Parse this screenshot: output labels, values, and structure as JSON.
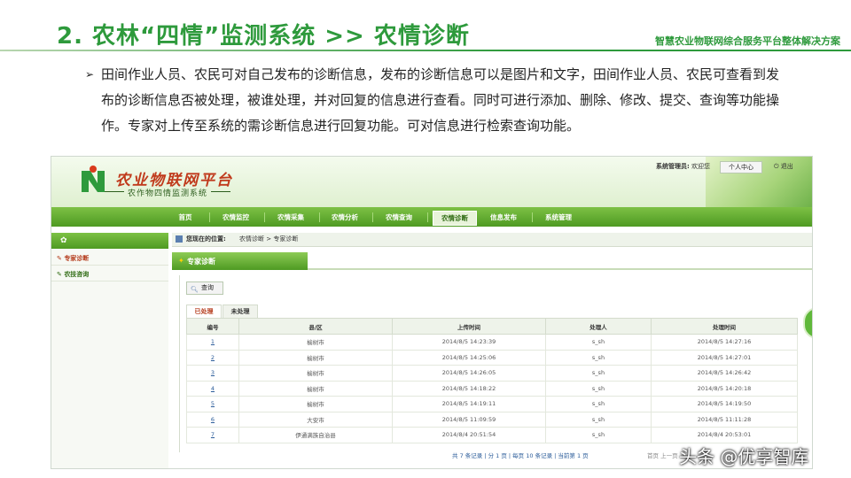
{
  "slide": {
    "title": "2. 农林“四情”监测系统  >> 农情诊断",
    "subtitle": "智慧农业物联网综合服务平台整体解决方案",
    "bullet_text": "田间作业人员、农民可对自己发布的诊断信息，发布的诊断信息可以是图片和文字，田间作业人员、农民可查看到发布的诊断信息否被处理，被谁处理，并对回复的信息进行查看。同时可进行添加、删除、修改、提交、查询等功能操作。专家对上传至系统的需诊断信息进行回复功能。可对信息进行检索查询功能。"
  },
  "app": {
    "logo_title": "农业物联网平台",
    "logo_subtitle": "农作物四情监测系统",
    "user_role": "系统管理员:",
    "user_welcome": "欢迎您",
    "user_center": "个人中心",
    "logout": "退出",
    "nav": [
      "首页",
      "农情监控",
      "农情采集",
      "农情分析",
      "农情查询",
      "农情诊断",
      "信息发布",
      "系统管理"
    ],
    "nav_active": "农情诊断",
    "sidebar": {
      "items": [
        "专家诊断",
        "农技咨询"
      ]
    },
    "breadcrumb_label": "您现在的位置:",
    "breadcrumb_path": "农情诊断 > 专家诊断",
    "section_title": "专家诊断",
    "query_button": "查询",
    "subtabs": [
      "已处理",
      "未处理"
    ],
    "table": {
      "headers": [
        "编号",
        "县/区",
        "上传时间",
        "处理人",
        "处理时间"
      ],
      "rows": [
        [
          "1",
          "榆树市",
          "2014/8/5 14:23:39",
          "s_sh",
          "2014/8/5 14:27:16"
        ],
        [
          "2",
          "榆树市",
          "2014/8/5 14:25:06",
          "s_sh",
          "2014/8/5 14:27:01"
        ],
        [
          "3",
          "榆树市",
          "2014/8/5 14:26:05",
          "s_sh",
          "2014/8/5 14:26:42"
        ],
        [
          "4",
          "榆树市",
          "2014/8/5 14:18:22",
          "s_sh",
          "2014/8/5 14:20:18"
        ],
        [
          "5",
          "榆树市",
          "2014/8/5 14:19:11",
          "s_sh",
          "2014/8/5 14:19:50"
        ],
        [
          "6",
          "大安市",
          "2014/8/5 11:09:59",
          "s_sh",
          "2014/8/5 11:11:28"
        ],
        [
          "7",
          "伊通满族自治县",
          "2014/8/4 20:51:54",
          "s_sh",
          "2014/8/4 20:53:01"
        ]
      ]
    },
    "pager": "共 7 条记录 | 分 1 页 | 每页 10 条记录 | 当前第 1 页",
    "pager_nav": "首页 上一页"
  },
  "watermark": "头条 @优享智库",
  "colors": {
    "accent_green": "#2e9a3c",
    "nav_green": "#4e9a22",
    "logo_red": "#c03a1c"
  }
}
